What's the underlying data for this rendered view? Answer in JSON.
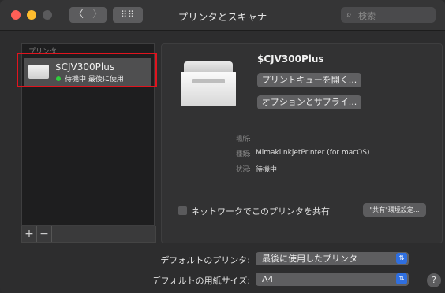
{
  "window": {
    "title": "プリンタとスキャナ"
  },
  "toolbar": {
    "back_glyph": "〈",
    "forward_glyph": "〉",
    "grid_glyph": "⠿⠿",
    "search_placeholder": "検索",
    "search_icon": "magnifier-icon"
  },
  "sidebar": {
    "header": "プリンタ",
    "printers": [
      {
        "name": "$CJV300Plus",
        "status": "待機中 最後に使用",
        "status_color": "#2fcf3c"
      }
    ],
    "add_label": "+",
    "remove_label": "−"
  },
  "detail": {
    "name": "$CJV300Plus",
    "open_queue_button": "プリントキューを開く...",
    "options_button": "オプションとサプライ...",
    "location_label": "場所:",
    "location_value": "",
    "kind_label": "種類:",
    "kind_value": "MimakiInkjetPrinter (for macOS)",
    "status_label": "状況:",
    "status_value": "待機中",
    "share_label": "ネットワークでこのプリンタを共有",
    "share_checked": false,
    "share_prefs_button": "\"共有\"環境設定..."
  },
  "defaults": {
    "printer_label": "デフォルトのプリンタ:",
    "printer_value": "最後に使用したプリンタ",
    "paper_label": "デフォルトの用紙サイズ:",
    "paper_value": "A4"
  },
  "help": "?",
  "colors": {
    "highlight": "#e0141e",
    "accent": "#2f6fe0"
  }
}
